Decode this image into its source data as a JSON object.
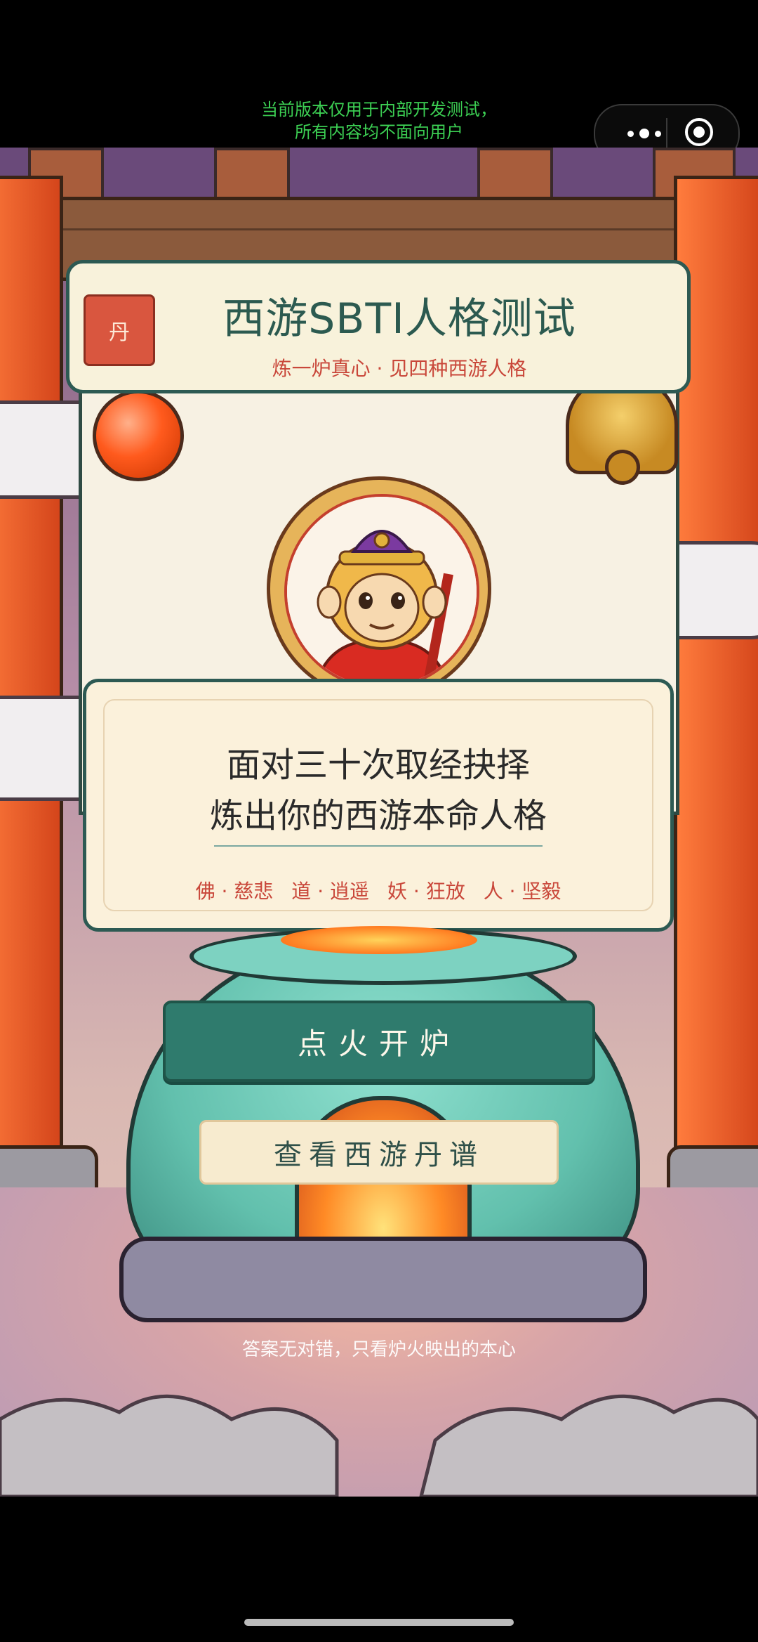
{
  "dev_banner": {
    "line1": "当前版本仅用于内部开发测试，",
    "line2": "所有内容均不面向用户"
  },
  "capsule": {
    "more_icon": "more-icon",
    "close_icon": "close-icon"
  },
  "header": {
    "badge": "丹",
    "title": "西游SBTI人格测试",
    "subtitle": "炼一炉真心 · 见四种西游人格"
  },
  "question_card": {
    "line1": "面对三十次取经抉择",
    "line2": "炼出你的西游本命人格",
    "tags": [
      "佛 · 慈悲",
      "道 · 逍遥",
      "妖 · 狂放",
      "人 · 坚毅"
    ]
  },
  "actions": {
    "primary_label": "点火开炉",
    "secondary_label": "查看西游丹谱"
  },
  "footnote": "答案无对错，只看炉火映出的本心",
  "colors": {
    "primary": "#2f7b6d",
    "accent_red": "#c9473a",
    "title_green": "#2c5a50",
    "dev_banner_green": "#3ccf53"
  }
}
